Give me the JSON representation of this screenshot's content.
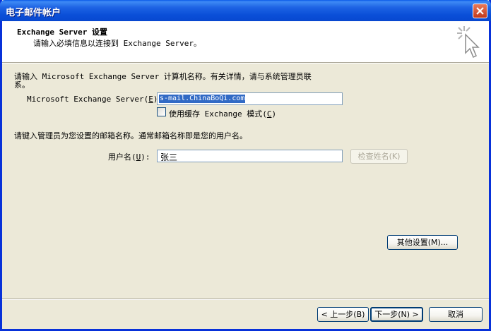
{
  "window": {
    "title": "电子邮件帐户"
  },
  "header": {
    "title": "Exchange Server 设置",
    "subtitle": "请输入必填信息以连接到 Exchange Server。"
  },
  "server_section": {
    "instruction": "请输入 Microsoft Exchange Server 计算机名称。有关详情，请与系统管理员联系。",
    "label_prefix": "Microsoft Exchange Server(",
    "label_key": "E",
    "label_suffix": "):",
    "value": "s-mail.ChinaBoQi.com",
    "cached_mode": {
      "checked": false,
      "label_prefix": "使用缓存 Exchange 模式(",
      "label_key": "C",
      "label_suffix": ")"
    }
  },
  "user_section": {
    "instruction": "请键入管理员为您设置的邮箱名称。通常邮箱名称即是您的用户名。",
    "label_prefix": "用户名(",
    "label_key": "U",
    "label_suffix": "):",
    "value": "张三",
    "check_name_button": "检查姓名(K)"
  },
  "more_settings_button": "其他设置(M)...",
  "footer": {
    "back_button": "< 上一步(B)",
    "next_button": "下一步(N) >",
    "cancel_button": "取消"
  },
  "colors": {
    "titlebar": "#0A4FD8",
    "dialog_bg": "#ECE9D8",
    "selection": "#316AC5",
    "input_border": "#7F9DB9"
  }
}
